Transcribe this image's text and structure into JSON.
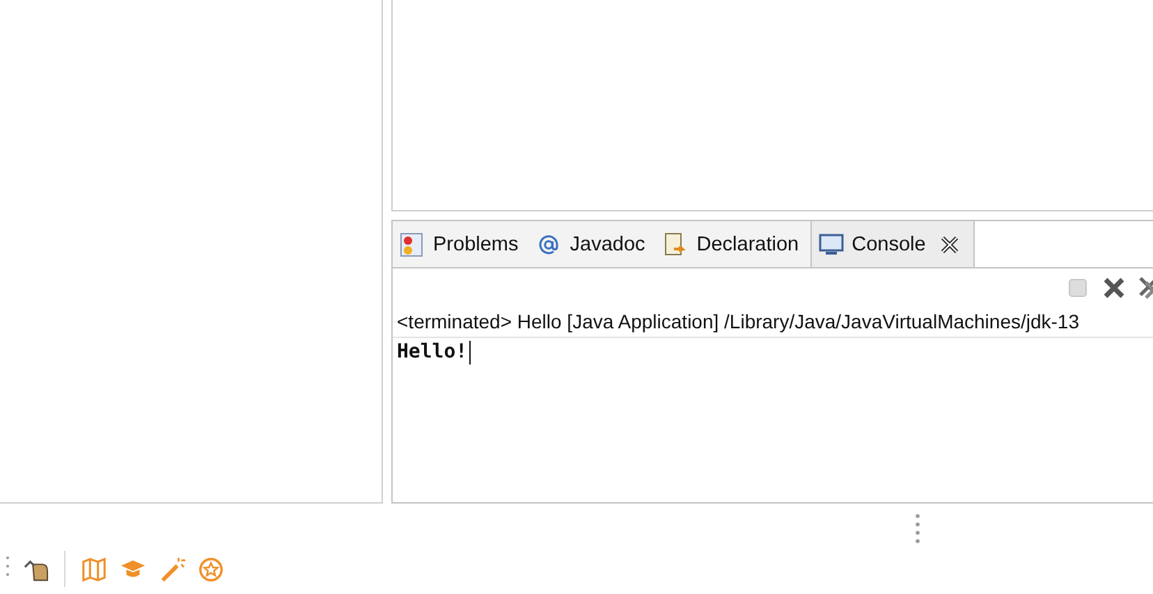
{
  "console_view": {
    "tabs": [
      {
        "label": "Problems",
        "kind": "problems",
        "selected": false
      },
      {
        "label": "Javadoc",
        "kind": "javadoc",
        "selected": false
      },
      {
        "label": "Declaration",
        "kind": "declaration",
        "selected": false
      },
      {
        "label": "Console",
        "kind": "console",
        "selected": true
      }
    ],
    "status_line": "<terminated> Hello [Java Application] /Library/Java/JavaVirtualMachines/jdk-13",
    "output": "Hello!"
  }
}
